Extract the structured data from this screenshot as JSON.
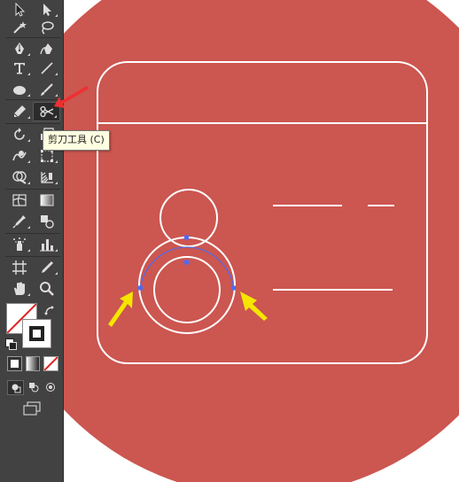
{
  "toolbar": {
    "tools": [
      [
        "selection-tool",
        "direct-selection-tool"
      ],
      [
        "magic-wand-tool",
        "lasso-tool"
      ],
      [
        "pen-tool",
        "curvature-tool"
      ],
      [
        "type-tool",
        "line-segment-tool"
      ],
      [
        "ellipse-tool",
        "paintbrush-tool"
      ],
      [
        "pencil-tool",
        "scissors-tool"
      ],
      [
        "rotate-tool",
        "scale-tool"
      ],
      [
        "warp-tool",
        "free-transform-tool"
      ],
      [
        "shape-builder-tool",
        "perspective-grid-tool"
      ],
      [
        "mesh-tool",
        "gradient-tool"
      ],
      [
        "eyedropper-tool",
        "blend-tool"
      ],
      [
        "symbol-sprayer-tool",
        "column-graph-tool"
      ],
      [
        "artboard-tool",
        "slice-tool"
      ],
      [
        "hand-tool",
        "zoom-tool"
      ]
    ],
    "active_tool": "scissors-tool",
    "tooltip": "剪刀工具 (C)"
  },
  "colors": {
    "toolbar_bg": "#424242",
    "canvas_bg": "#cc5650",
    "stroke": "#ffffff",
    "path_selection": "#4a6cf7",
    "arrow_yellow": "#f5e600",
    "arrow_red": "#ee3030"
  }
}
